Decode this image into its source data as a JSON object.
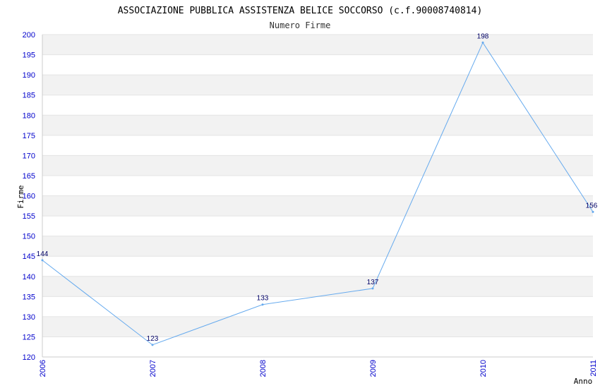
{
  "chart_data": {
    "type": "line",
    "title": "ASSOCIAZIONE PUBBLICA ASSISTENZA BELICE SOCCORSO (c.f.90008740814)",
    "subtitle": "Numero Firme",
    "xlabel": "Anno",
    "ylabel": "Firme",
    "x": [
      "2006",
      "2007",
      "2008",
      "2009",
      "2010",
      "2011"
    ],
    "series": [
      {
        "values": [
          144,
          123,
          133,
          137,
          198,
          156
        ]
      }
    ],
    "data_labels": [
      "144",
      "123",
      "133",
      "137",
      "198",
      "156"
    ],
    "y_ticks": [
      "120",
      "125",
      "130",
      "135",
      "140",
      "145",
      "150",
      "155",
      "160",
      "165",
      "170",
      "175",
      "180",
      "185",
      "190",
      "195",
      "200"
    ],
    "ylim": [
      120,
      200
    ],
    "grid": true,
    "colors": {
      "line": "#66aaee",
      "band": "#f2f2f2",
      "tick_text": "#0000cc",
      "data_label": "#000066"
    }
  }
}
